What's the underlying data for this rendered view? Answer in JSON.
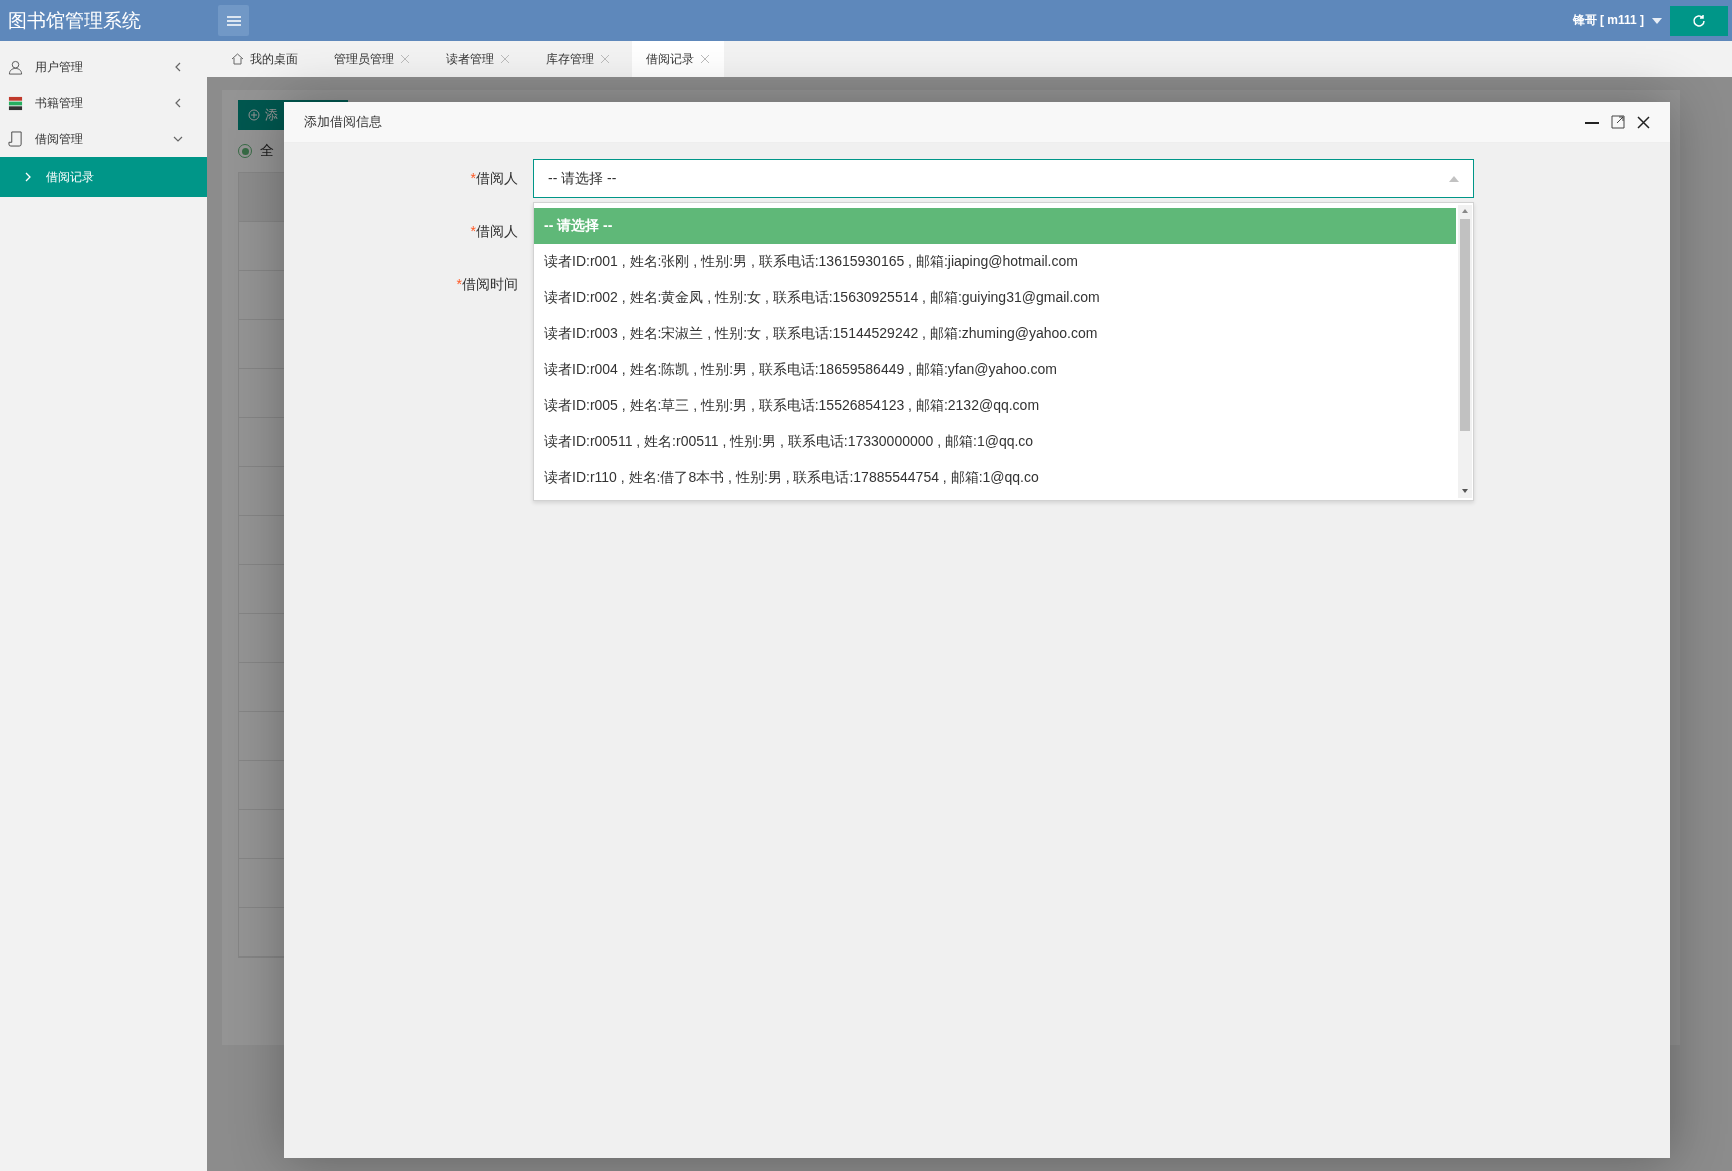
{
  "app": {
    "title": "图书馆管理系统",
    "user": "锋哥 [ m111 ]"
  },
  "sidebar": {
    "items": [
      {
        "label": "用户管理",
        "expanded": false
      },
      {
        "label": "书籍管理",
        "expanded": false
      },
      {
        "label": "借阅管理",
        "expanded": true,
        "children": [
          {
            "label": "借阅记录",
            "selected": true
          }
        ]
      }
    ]
  },
  "tabs": [
    {
      "label": "我的桌面",
      "home": true,
      "closable": false,
      "selected": false
    },
    {
      "label": "管理员管理",
      "closable": true,
      "selected": false
    },
    {
      "label": "读者管理",
      "closable": true,
      "selected": false
    },
    {
      "label": "库存管理",
      "closable": true,
      "selected": false
    },
    {
      "label": "借阅记录",
      "closable": true,
      "selected": true
    }
  ],
  "background": {
    "add_button": "添",
    "filter": {
      "label": "全",
      "selected": true
    }
  },
  "dialog": {
    "title": "添加借阅信息",
    "fields": [
      {
        "label": "借阅人",
        "required_mark": "*",
        "kind": "select",
        "value": "-- 请选择 --",
        "open": true,
        "options": [
          {
            "label": "-- 请选择 --",
            "selected": true
          },
          {
            "label": "读者ID:r001 , 姓名:张刚 , 性别:男 , 联系电话:13615930165  , 邮箱:jiaping@hotmail.com",
            "selected": false
          },
          {
            "label": "读者ID:r002 , 姓名:黄金凤 , 性别:女 , 联系电话:15630925514  , 邮箱:guiying31@gmail.com",
            "selected": false
          },
          {
            "label": "读者ID:r003 , 姓名:宋淑兰 , 性别:女 , 联系电话:15144529242  , 邮箱:zhuming@yahoo.com",
            "selected": false
          },
          {
            "label": "读者ID:r004 , 姓名:陈凯 , 性别:男 , 联系电话:18659586449  , 邮箱:yfan@yahoo.com",
            "selected": false
          },
          {
            "label": "读者ID:r005 , 姓名:草三 , 性别:男 , 联系电话:15526854123 , 邮箱:2132@qq.com",
            "selected": false
          },
          {
            "label": "读者ID:r00511 , 姓名:r00511 , 性别:男 , 联系电话:17330000000 , 邮箱:1@qq.co",
            "selected": false
          },
          {
            "label": "读者ID:r110 , 姓名:借了8本书 , 性别:男 , 联系电话:17885544754 , 邮箱:1@qq.co",
            "selected": false
          }
        ]
      },
      {
        "label": "借阅人",
        "required_mark": "*"
      },
      {
        "label": "借阅时间",
        "required_mark": "*"
      }
    ]
  }
}
